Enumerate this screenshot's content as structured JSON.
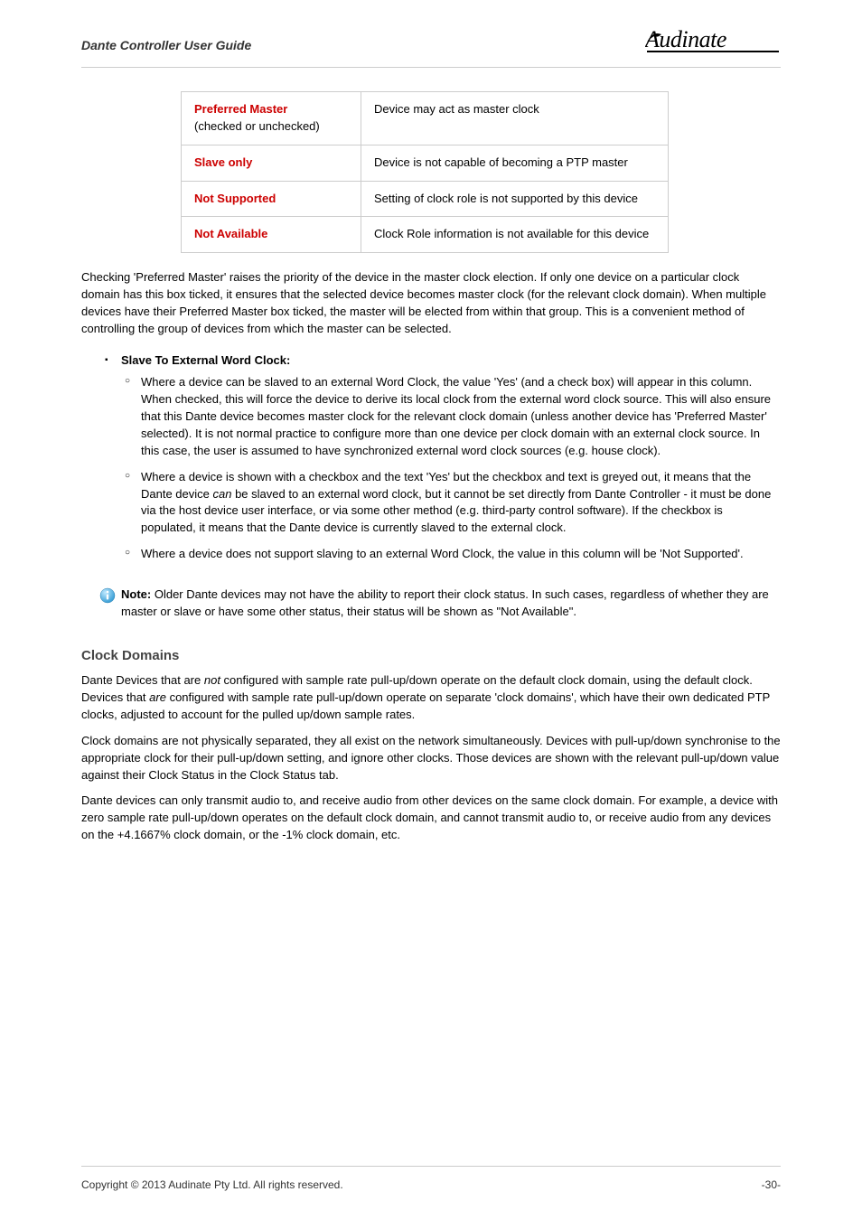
{
  "header": {
    "title": "Dante Controller User Guide"
  },
  "table": {
    "rows": [
      {
        "key": "Preferred Master",
        "sub": "(checked or unchecked)",
        "value": "Device may act as master clock"
      },
      {
        "key": "Slave only",
        "sub": "",
        "value": "Device is not capable of becoming a PTP master"
      },
      {
        "key": "Not Supported",
        "sub": "",
        "value": "Setting of clock role is not supported by this device"
      },
      {
        "key": "Not Available",
        "sub": "",
        "value": "Clock Role information is not available for this device"
      }
    ]
  },
  "para": {
    "p1": "Checking 'Preferred Master' raises the priority of the device in the master clock election. If only one device on a particular clock domain has this box ticked, it ensures that the selected device becomes master clock (for the relevant clock domain). When multiple devices have their Preferred Master box ticked, the master will be elected from within that group. This is a convenient method of controlling the group of devices from which the master can be selected."
  },
  "bullet1": {
    "heading": "Slave To External Word Clock",
    "items": [
      "Where a device can be slaved to an external Word Clock, the value 'Yes' (and a check box) will appear in this column. When checked, this will force the device to derive its local clock from the external word clock source. This will also ensure that this Dante device becomes master clock for the relevant clock domain (unless another device has 'Preferred Master' selected). It is not normal practice to configure more than one device per clock domain with an external clock source. In this case, the user is assumed to have synchronized external word clock sources (e.g. house clock).",
      {
        "pre": "Where a device is shown with a checkbox and the text 'Yes' but the checkbox and text is greyed out, it means that the Dante device ",
        "em": "can",
        "post": " be slaved to an external word clock, but it cannot be set directly from Dante Controller - it must be done via the host device user interface, or via some other method (e.g. third-party control software). If the checkbox is populated, it means that the Dante device is currently slaved to the external clock."
      },
      "Where a device does not support slaving to an external Word Clock, the value in this column will be 'Not Supported'."
    ]
  },
  "note": {
    "label": "Note:",
    "space": "  ",
    "text": "Older Dante devices may not have the ability to report their clock status. In such cases, regardless of whether they are master or slave or have some other status, their status will be shown as \"Not Available\"."
  },
  "section": {
    "title": "Clock Domains",
    "p1_pre": "Dante Devices that are ",
    "p1_em1": "not",
    "p1_mid": " configured with sample rate pull-up/down operate on the default clock domain, using the default clock. Devices that ",
    "p1_em2": "are",
    "p1_post": " configured with sample rate pull-up/down operate on separate 'clock domains', which have their own dedicated PTP clocks, adjusted to account for the pulled up/down sample rates.",
    "p2": "Clock domains are not physically separated, they all exist on the network simultaneously. Devices with pull-up/down synchronise to the appropriate clock for their pull-up/down setting, and ignore other clocks. Those devices are shown with the relevant pull-up/down value against their Clock Status in the Clock Status tab.",
    "p3": "Dante devices can only transmit audio to, and receive audio from other devices on the same clock domain. For example, a device with zero sample rate pull-up/down operates on the default clock domain, and cannot transmit audio to, or receive audio from any devices on the +4.1667% clock domain, or the -1% clock domain, etc."
  },
  "footer": {
    "copyright": "Copyright © 2013 Audinate Pty Ltd. All rights reserved.",
    "page": "-30-"
  }
}
